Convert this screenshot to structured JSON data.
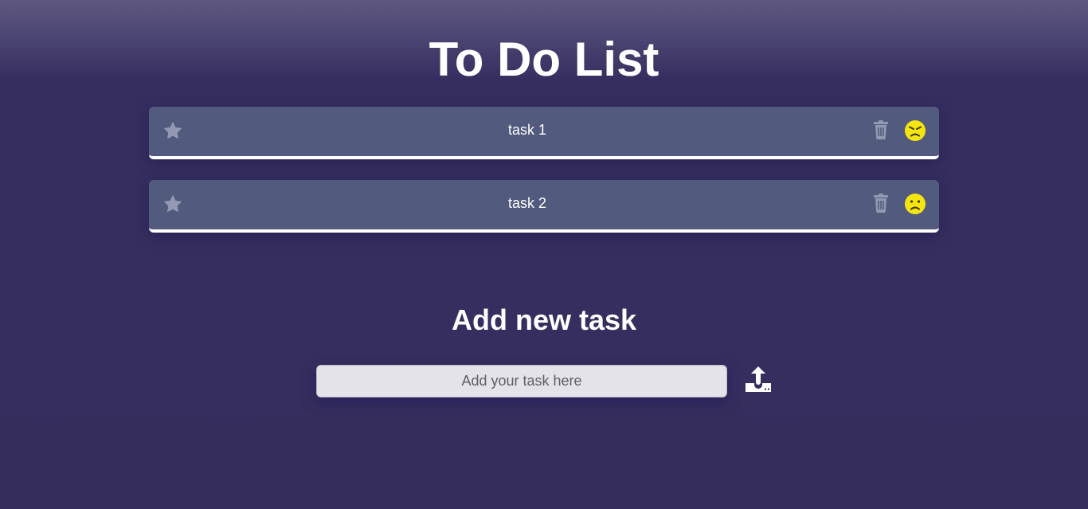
{
  "header": {
    "title": "To Do List"
  },
  "tasks": [
    {
      "label": "task 1",
      "icons": [
        "star-icon",
        "trash-icon",
        "angry-face-icon"
      ]
    },
    {
      "label": "task 2",
      "icons": [
        "star-icon",
        "trash-icon",
        "sad-face-icon"
      ]
    }
  ],
  "add_section": {
    "title": "Add new task",
    "placeholder": "Add your task here",
    "value": "",
    "submit_icon": "upload-icon"
  },
  "colors": {
    "task_bg": "#525a7d",
    "icon_muted": "#9499b3",
    "face_yellow": "#f5e50f"
  }
}
